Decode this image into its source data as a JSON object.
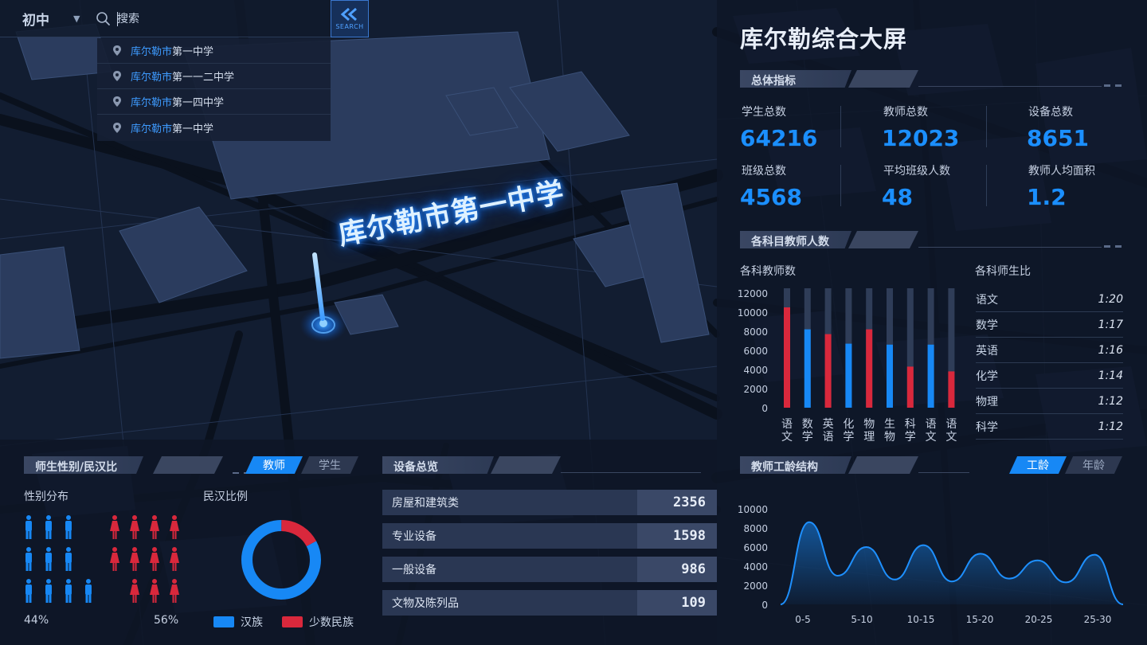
{
  "search": {
    "level_label": "初中",
    "placeholder": "搜索",
    "button_label": "SEARCH",
    "suggestions": [
      {
        "highlight": "库尔勒市",
        "rest": "第一中学"
      },
      {
        "highlight": "库尔勒市",
        "rest": "第一一二中学"
      },
      {
        "highlight": "库尔勒市",
        "rest": "第一四中学"
      },
      {
        "highlight": "库尔勒市",
        "rest": "第一中学"
      }
    ]
  },
  "map": {
    "selected_school": "库尔勒市第一中学"
  },
  "panel": {
    "title": "库尔勒综合大屏"
  },
  "overview": {
    "title": "总体指标",
    "kpis": [
      {
        "label": "学生总数",
        "value": "64216"
      },
      {
        "label": "教师总数",
        "value": "12023"
      },
      {
        "label": "设备总数",
        "value": "8651"
      },
      {
        "label": "班级总数",
        "value": "4568"
      },
      {
        "label": "平均班级人数",
        "value": "48"
      },
      {
        "label": "教师人均面积",
        "value": "1.2"
      }
    ]
  },
  "subject_teachers": {
    "title": "各科目教师人数",
    "chart_subtitle": "各科教师数",
    "ratio_subtitle": "各科师生比",
    "ratios": [
      {
        "subject": "语文",
        "ratio": "1:20"
      },
      {
        "subject": "数学",
        "ratio": "1:17"
      },
      {
        "subject": "英语",
        "ratio": "1:16"
      },
      {
        "subject": "化学",
        "ratio": "1:14"
      },
      {
        "subject": "物理",
        "ratio": "1:12"
      },
      {
        "subject": "科学",
        "ratio": "1:12"
      }
    ]
  },
  "gender": {
    "title": "师生性别/民汉比",
    "tab_teacher": "教师",
    "tab_student": "学生",
    "gender_subtitle": "性别分布",
    "ethnic_subtitle": "民汉比例",
    "male_pct": "44%",
    "female_pct": "56%",
    "legend_han": "汉族",
    "legend_minority": "少数民族"
  },
  "equipment": {
    "title": "设备总览",
    "items": [
      {
        "name": "房屋和建筑类",
        "value": "2356"
      },
      {
        "name": "专业设备",
        "value": "1598"
      },
      {
        "name": "一般设备",
        "value": "986"
      },
      {
        "name": "文物及陈列品",
        "value": "109"
      }
    ]
  },
  "seniority": {
    "title": "教师工龄结构",
    "tab_seniority": "工龄",
    "tab_age": "年龄"
  },
  "colors": {
    "accent": "#1b8fff",
    "red": "#d9283c",
    "blue": "#1788f5",
    "track": "#2f3d58"
  },
  "icons": [
    "search-icon",
    "chevron-down-icon",
    "double-chevron-left-icon",
    "location-pin-icon",
    "male-person-icon",
    "female-person-icon"
  ],
  "chart_data": [
    {
      "type": "bar",
      "title": "各科教师数",
      "categories": [
        "语文",
        "数学",
        "英语",
        "化学",
        "物理",
        "生物",
        "科学",
        "语文",
        "语文"
      ],
      "values": [
        10500,
        8200,
        7700,
        6700,
        8200,
        6600,
        4300,
        6600,
        3800
      ],
      "ylim": [
        0,
        12000
      ],
      "yticks": [
        0,
        2000,
        4000,
        6000,
        8000,
        10000,
        12000
      ],
      "bar_colors": [
        "red",
        "blue",
        "red",
        "blue",
        "red",
        "blue",
        "red",
        "blue",
        "red"
      ],
      "track_max": 12500
    },
    {
      "type": "area",
      "title": "教师工龄结构",
      "x": [
        "0-5",
        "5-10",
        "10-15",
        "15-20",
        "20-25",
        "25-30"
      ],
      "peaks": [
        8600,
        6000,
        6200,
        5300,
        4600,
        5200
      ],
      "valleys": [
        3000,
        2600,
        2400,
        2700,
        2300
      ],
      "ylim": [
        0,
        10000
      ],
      "yticks": [
        0,
        2000,
        4000,
        6000,
        8000,
        10000
      ]
    },
    {
      "type": "pie",
      "title": "民汉比例",
      "labels": [
        "汉族",
        "少数民族"
      ],
      "values": [
        0.83,
        0.17
      ]
    },
    {
      "type": "pictogram",
      "title": "性别分布",
      "labels": [
        "男",
        "女"
      ],
      "values": [
        0.44,
        0.56
      ],
      "counts": [
        11,
        11
      ]
    }
  ]
}
